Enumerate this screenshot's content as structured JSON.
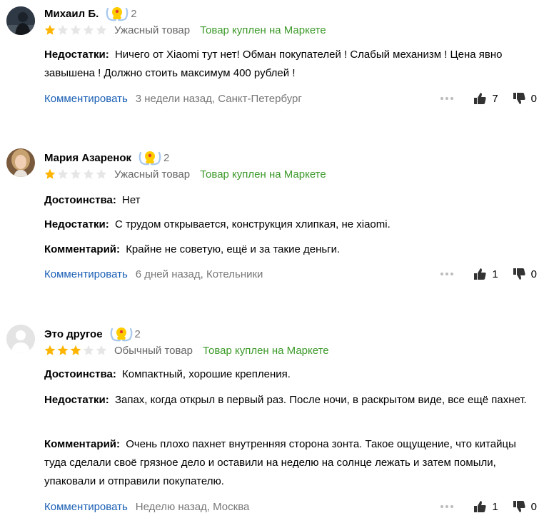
{
  "reviews": [
    {
      "author": "Михаил Б.",
      "badge_count": "2",
      "rating": 1,
      "rating_text": "Ужасный товар",
      "bought": "Товар куплен на Маркете",
      "fields": [
        {
          "label": "Недостатки:",
          "text": "Ничего от Xiaomi тут нет! Обман покупателей ! Слабый механизм ! Цена явно завышена ! Должно стоить максимум 400 рублей !"
        }
      ],
      "comment_label": "Комментировать",
      "meta": "3 недели назад, Санкт-Петербург",
      "likes": "7",
      "dislikes": "0"
    },
    {
      "author": "Мария Азаренок",
      "badge_count": "2",
      "rating": 1,
      "rating_text": "Ужасный товар",
      "bought": "Товар куплен на Маркете",
      "fields": [
        {
          "label": "Достоинства:",
          "text": "Нет"
        },
        {
          "label": "Недостатки:",
          "text": "С трудом открывается, конструкция хлипкая, не xiaomi."
        },
        {
          "label": "Комментарий:",
          "text": "Крайне не советую, ещё и за такие деньги."
        }
      ],
      "comment_label": "Комментировать",
      "meta": "6 дней назад, Котельники",
      "likes": "1",
      "dislikes": "0"
    },
    {
      "author": "Это другое",
      "badge_count": "2",
      "rating": 3,
      "rating_text": "Обычный товар",
      "bought": "Товар куплен на Маркете",
      "fields": [
        {
          "label": "Достоинства:",
          "text": "Компактный, хорошие крепления."
        },
        {
          "label": "Недостатки:",
          "text": "Запах, когда открыл в первый раз. После ночи, в раскрытом виде, все ещё пахнет."
        },
        {
          "label": "Комментарий:",
          "text": "Очень плохо пахнет внутренняя сторона зонта. Такое ощущение, что китайцы туда сделали своё грязное дело и оставили на неделю на солнце лежать и затем помыли, упаковали и отправили покупателю."
        }
      ],
      "comment_label": "Комментировать",
      "meta": "Неделю назад, Москва",
      "likes": "1",
      "dislikes": "0"
    }
  ],
  "colors": {
    "star_on": "#ffb400",
    "star_off": "#e6e6e6",
    "link": "#1a5fb4",
    "bought": "#3c9a2a"
  }
}
